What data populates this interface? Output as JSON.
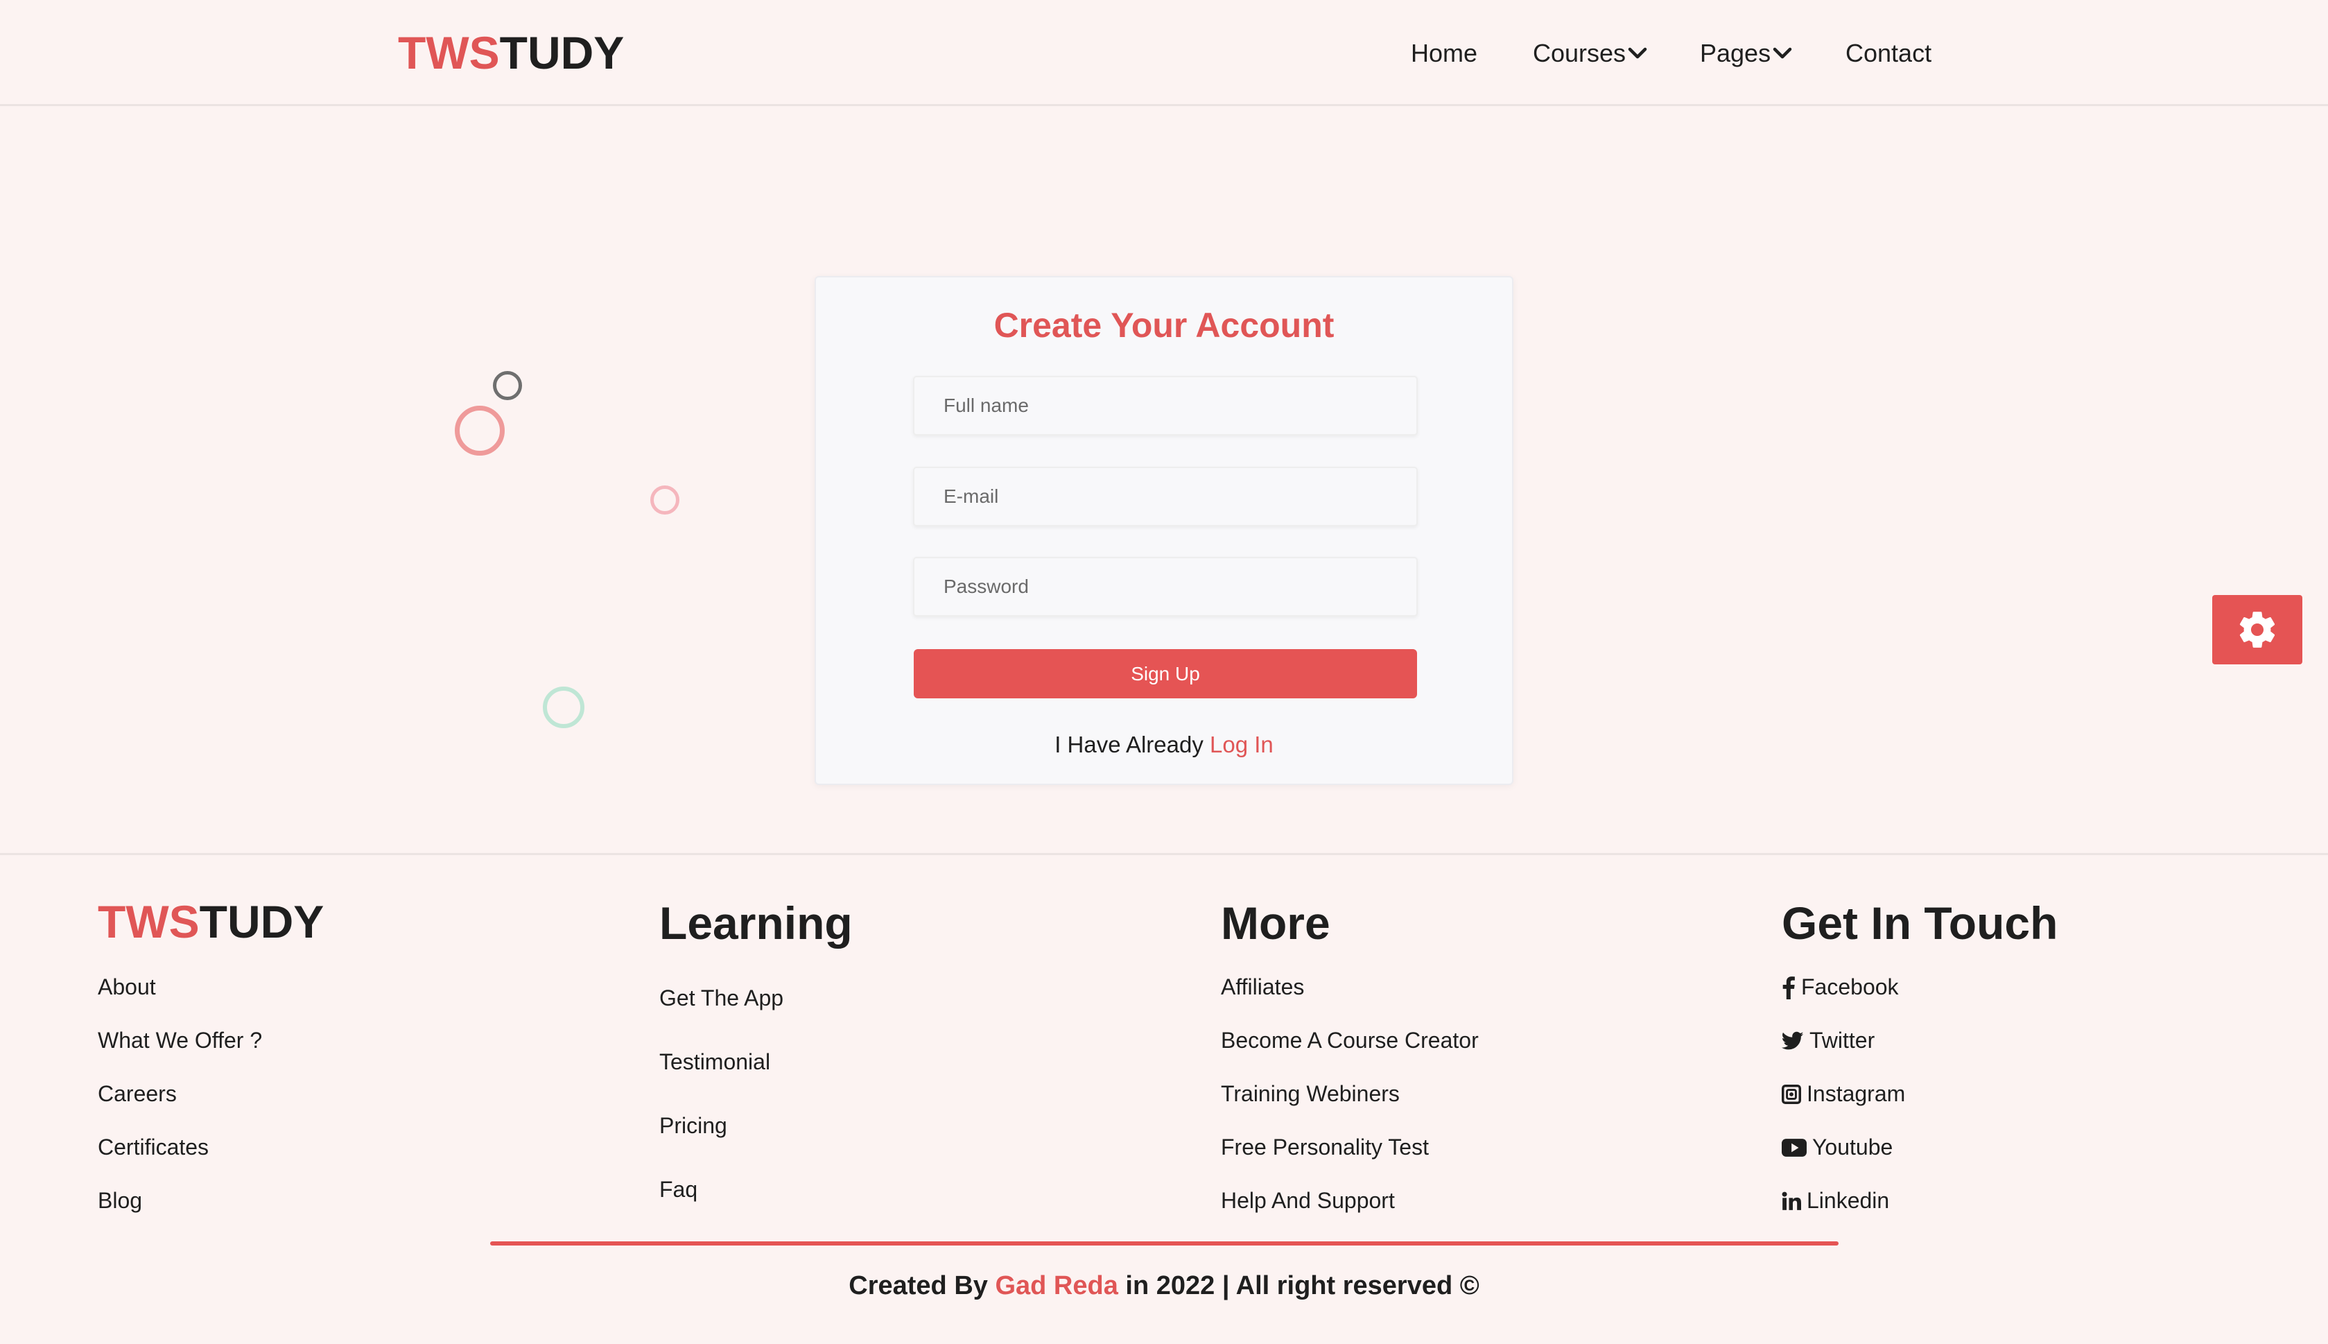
{
  "brand": {
    "part1": "TWS",
    "part2": "TUDY"
  },
  "nav": {
    "items": [
      {
        "label": "Home"
      },
      {
        "label": "Courses"
      },
      {
        "label": "Pages"
      },
      {
        "label": "Contact"
      }
    ]
  },
  "form": {
    "title": "Create Your Account",
    "fullname_placeholder": "Full name",
    "email_placeholder": "E-mail",
    "password_placeholder": "Password",
    "signup_label": "Sign Up",
    "already_text": "I Have Already",
    "login_link": "Log In"
  },
  "footer": {
    "learning_title": "Learning",
    "more_title": "More",
    "touch_title": "Get In Touch",
    "brand_links": [
      "About",
      "What We Offer ?",
      "Careers",
      "Certificates",
      "Blog"
    ],
    "learning_links": [
      "Get The App",
      "Testimonial",
      "Pricing",
      "Faq"
    ],
    "more_links": [
      "Affiliates",
      "Become A Course Creator",
      "Training Webiners",
      "Free Personality Test",
      "Help And Support"
    ],
    "social_links": [
      {
        "label": "Facebook",
        "icon": "facebook-icon"
      },
      {
        "label": "Twitter",
        "icon": "twitter-icon"
      },
      {
        "label": "Instagram",
        "icon": "instagram-icon"
      },
      {
        "label": "Youtube",
        "icon": "youtube-icon"
      },
      {
        "label": "Linkedin",
        "icon": "linkedin-icon"
      }
    ],
    "credits": {
      "prefix": "Created By",
      "author": "Gad Reda",
      "suffix": "in 2022 | All right reserved ©"
    }
  },
  "colors": {
    "accent": "#e55454",
    "background": "#fcf3f2",
    "text": "#1f1f1f"
  },
  "icons": {
    "settings": "gear-icon",
    "dropdown": "chevron-down-icon"
  }
}
